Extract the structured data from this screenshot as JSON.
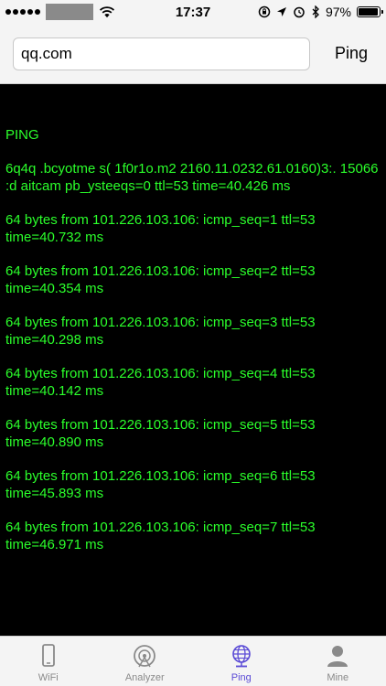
{
  "status_bar": {
    "time": "17:37",
    "battery_percent": 97,
    "battery_label": "97%"
  },
  "header": {
    "host_value": "qq.com",
    "ping_label": "Ping"
  },
  "output": {
    "lines": [
      "PING",
      "6q4q .bcyotme s( 1f0r1o.m2 2160.11.0232.61.0160)3:. 15066 :d aitcam pb_ysteeqs=0 ttl=53 time=40.426 ms",
      "64 bytes from 101.226.103.106: icmp_seq=1 ttl=53 time=40.732 ms",
      "64 bytes from 101.226.103.106: icmp_seq=2 ttl=53 time=40.354 ms",
      "64 bytes from 101.226.103.106: icmp_seq=3 ttl=53 time=40.298 ms",
      "64 bytes from 101.226.103.106: icmp_seq=4 ttl=53 time=40.142 ms",
      "64 bytes from 101.226.103.106: icmp_seq=5 ttl=53 time=40.890 ms",
      "64 bytes from 101.226.103.106: icmp_seq=6 ttl=53 time=45.893 ms",
      "64 bytes from 101.226.103.106: icmp_seq=7 ttl=53 time=46.971 ms"
    ]
  },
  "tabs": [
    {
      "label": "WiFi",
      "icon": "phone-icon",
      "active": false
    },
    {
      "label": "Analyzer",
      "icon": "radar-icon",
      "active": false
    },
    {
      "label": "Ping",
      "icon": "globe-icon",
      "active": true
    },
    {
      "label": "Mine",
      "icon": "person-icon",
      "active": false
    }
  ],
  "colors": {
    "output_text": "#2bff2b",
    "active_tab": "#5b4bd6",
    "inactive_tab": "#8a8a8a"
  }
}
